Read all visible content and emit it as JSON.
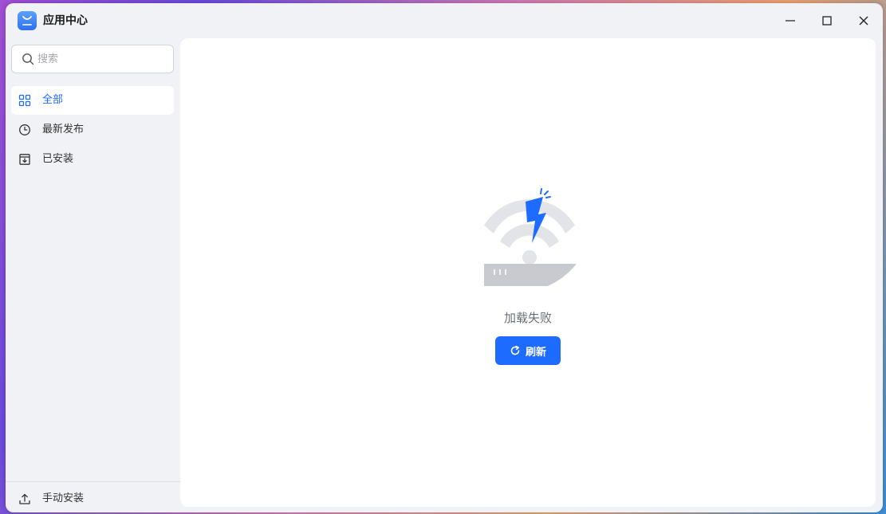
{
  "app": {
    "title": "应用中心",
    "icon": "store-icon",
    "accent_color": "#1e6bff"
  },
  "window_controls": {
    "minimize": "minimize-icon",
    "maximize": "maximize-icon",
    "close": "close-icon"
  },
  "sidebar": {
    "search": {
      "placeholder": "搜索",
      "value": ""
    },
    "items": [
      {
        "label": "全部",
        "icon": "grid-icon",
        "active": true
      },
      {
        "label": "最新发布",
        "icon": "clock-icon",
        "active": false
      },
      {
        "label": "已安装",
        "icon": "install-box-icon",
        "active": false
      }
    ],
    "footer": {
      "label": "手动安装",
      "icon": "upload-icon"
    }
  },
  "main": {
    "status_text": "加载失败",
    "refresh_label": "刷新",
    "illustration": "network-error-icon"
  }
}
